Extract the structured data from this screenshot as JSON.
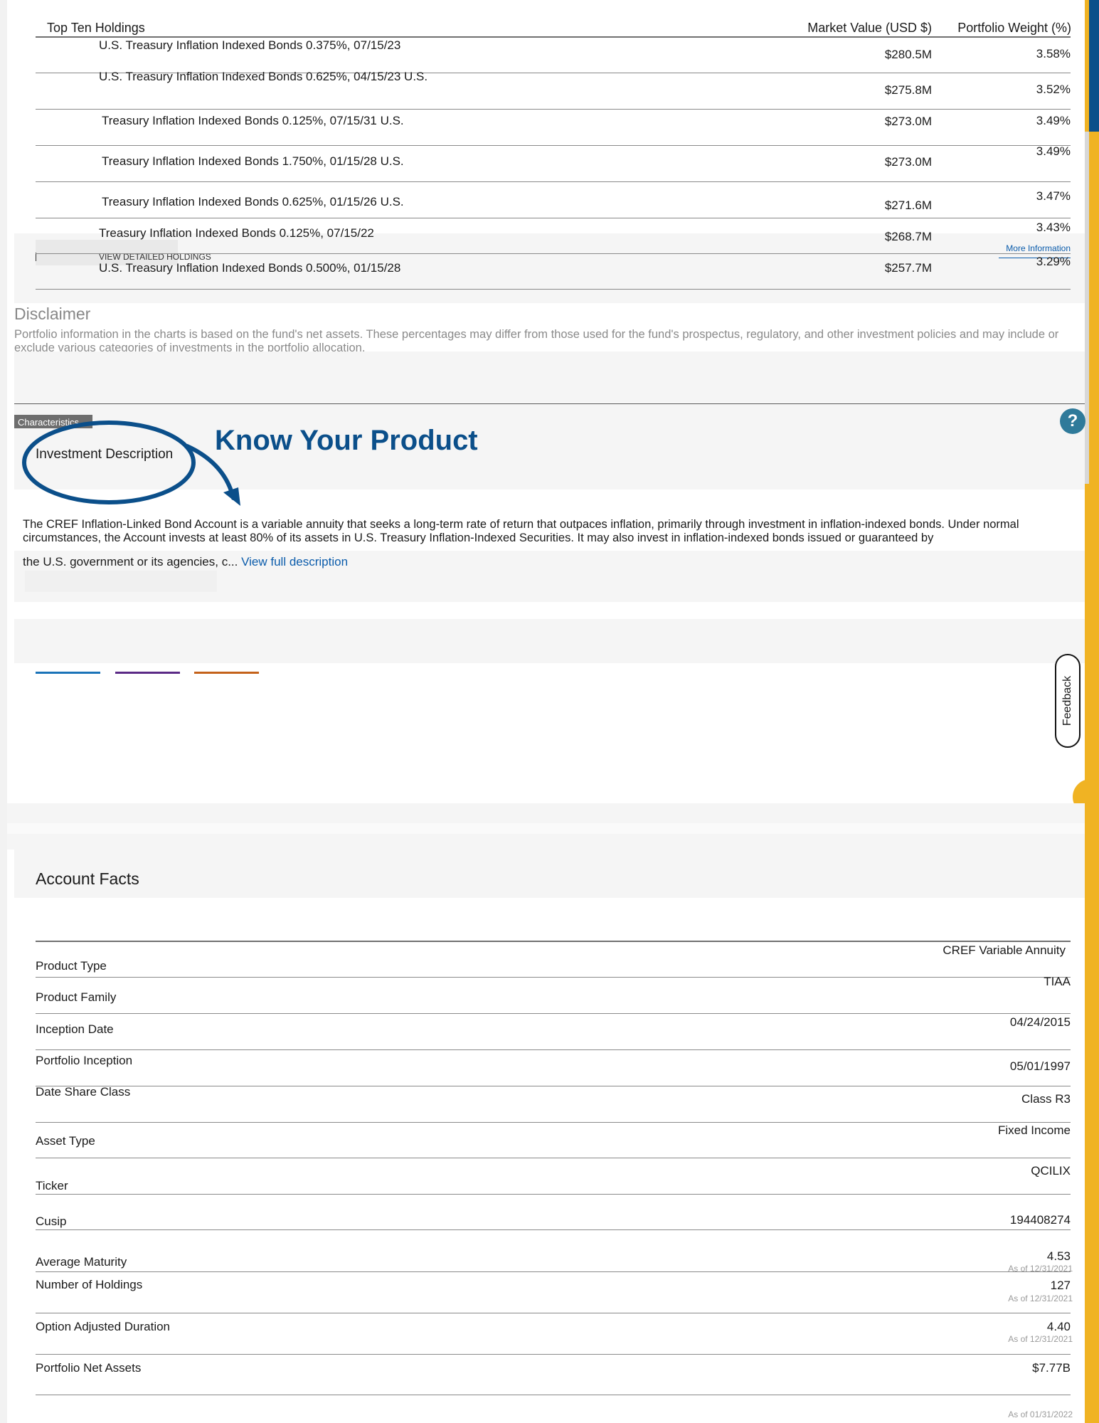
{
  "holdings": {
    "header": {
      "name": "Top Ten Holdings",
      "market_value": "Market Value (USD $)",
      "weight": "Portfolio Weight (%)"
    },
    "rows": [
      {
        "name": "U.S. Treasury Inflation Indexed Bonds 0.375%, 07/15/23",
        "value": "$280.5M",
        "weight": "3.58%"
      },
      {
        "name": "U.S. Treasury Inflation Indexed Bonds 0.625%, 04/15/23 U.S.",
        "value": "$275.8M",
        "weight": "3.52%"
      },
      {
        "name": "Treasury Inflation Indexed Bonds 0.125%, 07/15/31 U.S.",
        "value": "$273.0M",
        "weight": "3.49%"
      },
      {
        "name": "Treasury Inflation Indexed Bonds 1.750%, 01/15/28 U.S.",
        "value": "$273.0M",
        "weight": "3.49%"
      },
      {
        "name": "Treasury Inflation Indexed Bonds 0.625%, 01/15/26 U.S.",
        "value": "$271.6M",
        "weight": "3.47%"
      },
      {
        "name": "Treasury Inflation Indexed Bonds 0.125%, 07/15/22",
        "value": "$268.7M",
        "weight": "3.43%"
      },
      {
        "name": "U.S. Treasury Inflation Indexed Bonds 0.500%, 01/15/28",
        "value": "$257.7M",
        "weight": "3.29%"
      }
    ],
    "view_detailed": "VIEW DETAILED HOLDINGS",
    "more_info": "More Information"
  },
  "disclaimer": {
    "title": "Disclaimer",
    "text": "Portfolio information in the charts is based on the fund's net assets. These percentages may differ from those used for the fund's prospectus, regulatory, and other investment policies and may include or exclude various categories of investments in the portfolio allocation."
  },
  "characteristics": {
    "tab_label": "Characteristics",
    "help_glyph": "?",
    "section_title": "Investment Description",
    "annotation": "Know Your Product",
    "desc_line1": "The CREF Inflation-Linked Bond Account is a variable annuity that seeks a long-term rate of return that outpaces inflation, primarily through investment in inflation-indexed bonds. Under normal circumstances, the Account invests at least 80% of its assets in U.S. Treasury Inflation-Indexed Securities. It may also invest in inflation-indexed bonds issued or guaranteed by",
    "desc_line2": "the U.S. government or its agencies, c...",
    "view_full": "View full description"
  },
  "feedback": {
    "label": "Feedback"
  },
  "account_facts": {
    "title": "Account Facts",
    "rows": [
      {
        "label": "Product Type",
        "value": "CREF Variable Annuity",
        "asof": ""
      },
      {
        "label": "Product Family",
        "value": "TIAA",
        "asof": ""
      },
      {
        "label": "Inception Date",
        "value": "04/24/2015",
        "asof": ""
      },
      {
        "label": "Portfolio Inception",
        "value": "05/01/1997",
        "asof": ""
      },
      {
        "label": "Date Share Class",
        "value": "Class R3",
        "asof": ""
      },
      {
        "label": "Asset Type",
        "value": "Fixed Income",
        "asof": ""
      },
      {
        "label": "Ticker",
        "value": "QCILIX",
        "asof": ""
      },
      {
        "label": "Cusip",
        "value": "194408274",
        "asof": ""
      },
      {
        "label": "Average Maturity",
        "value": "4.53",
        "asof": "As of 12/31/2021"
      },
      {
        "label": "Number of Holdings",
        "value": "127",
        "asof": "As of 12/31/2021"
      },
      {
        "label": "Option Adjusted Duration",
        "value": "4.40",
        "asof": "As of 12/31/2021"
      },
      {
        "label": "Portfolio Net Assets",
        "value": "$7.77B",
        "asof": "As of 01/31/2022"
      }
    ]
  },
  "colors": {
    "accent_yellow": "#f0b323",
    "brand_blue": "#0b4f8a",
    "link_blue": "#0b5cab",
    "help_teal": "#2f7a9a"
  }
}
